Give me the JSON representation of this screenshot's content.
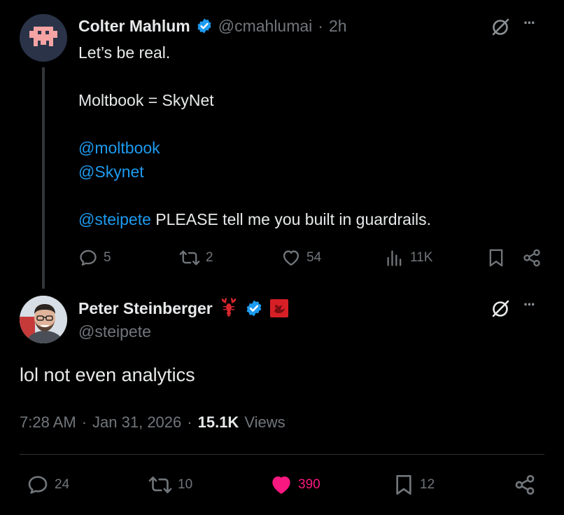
{
  "parent_tweet": {
    "author_name": "Colter Mahlum",
    "handle": "@cmahlumai",
    "separator": "·",
    "time": "2h",
    "text_line1": "Let’s be real.",
    "text_line2": "Moltbook = SkyNet",
    "mention1": "@moltbook",
    "mention2": "@Skynet",
    "mention3": "@steipete",
    "text_line5_rest": " PLEASE tell me you built in guardrails.",
    "replies": "5",
    "reposts": "2",
    "likes": "54",
    "views": "11K",
    "more_label": "···"
  },
  "main_tweet": {
    "author_name": "Peter Steinberger",
    "handle": "@steipete",
    "text": "lol not even analytics",
    "time": "7:28 AM",
    "sep1": "·",
    "date": "Jan 31, 2026",
    "sep2": "·",
    "views_count": "15.1K",
    "views_label": "Views",
    "replies": "24",
    "reposts": "10",
    "likes": "390",
    "bookmarks": "12",
    "more_label": "···"
  },
  "colors": {
    "background": "#000000",
    "text": "#e7e9ea",
    "muted": "#71767b",
    "link": "#1d9bf0",
    "like_active": "#f91880",
    "verified": "#1d9bf0"
  },
  "icons": [
    "reply-icon",
    "repost-icon",
    "like-icon",
    "views-icon",
    "bookmark-icon",
    "share-icon",
    "grok-icon",
    "more-icon",
    "verified-badge-icon",
    "lobster-icon",
    "affiliate-badge-icon"
  ]
}
